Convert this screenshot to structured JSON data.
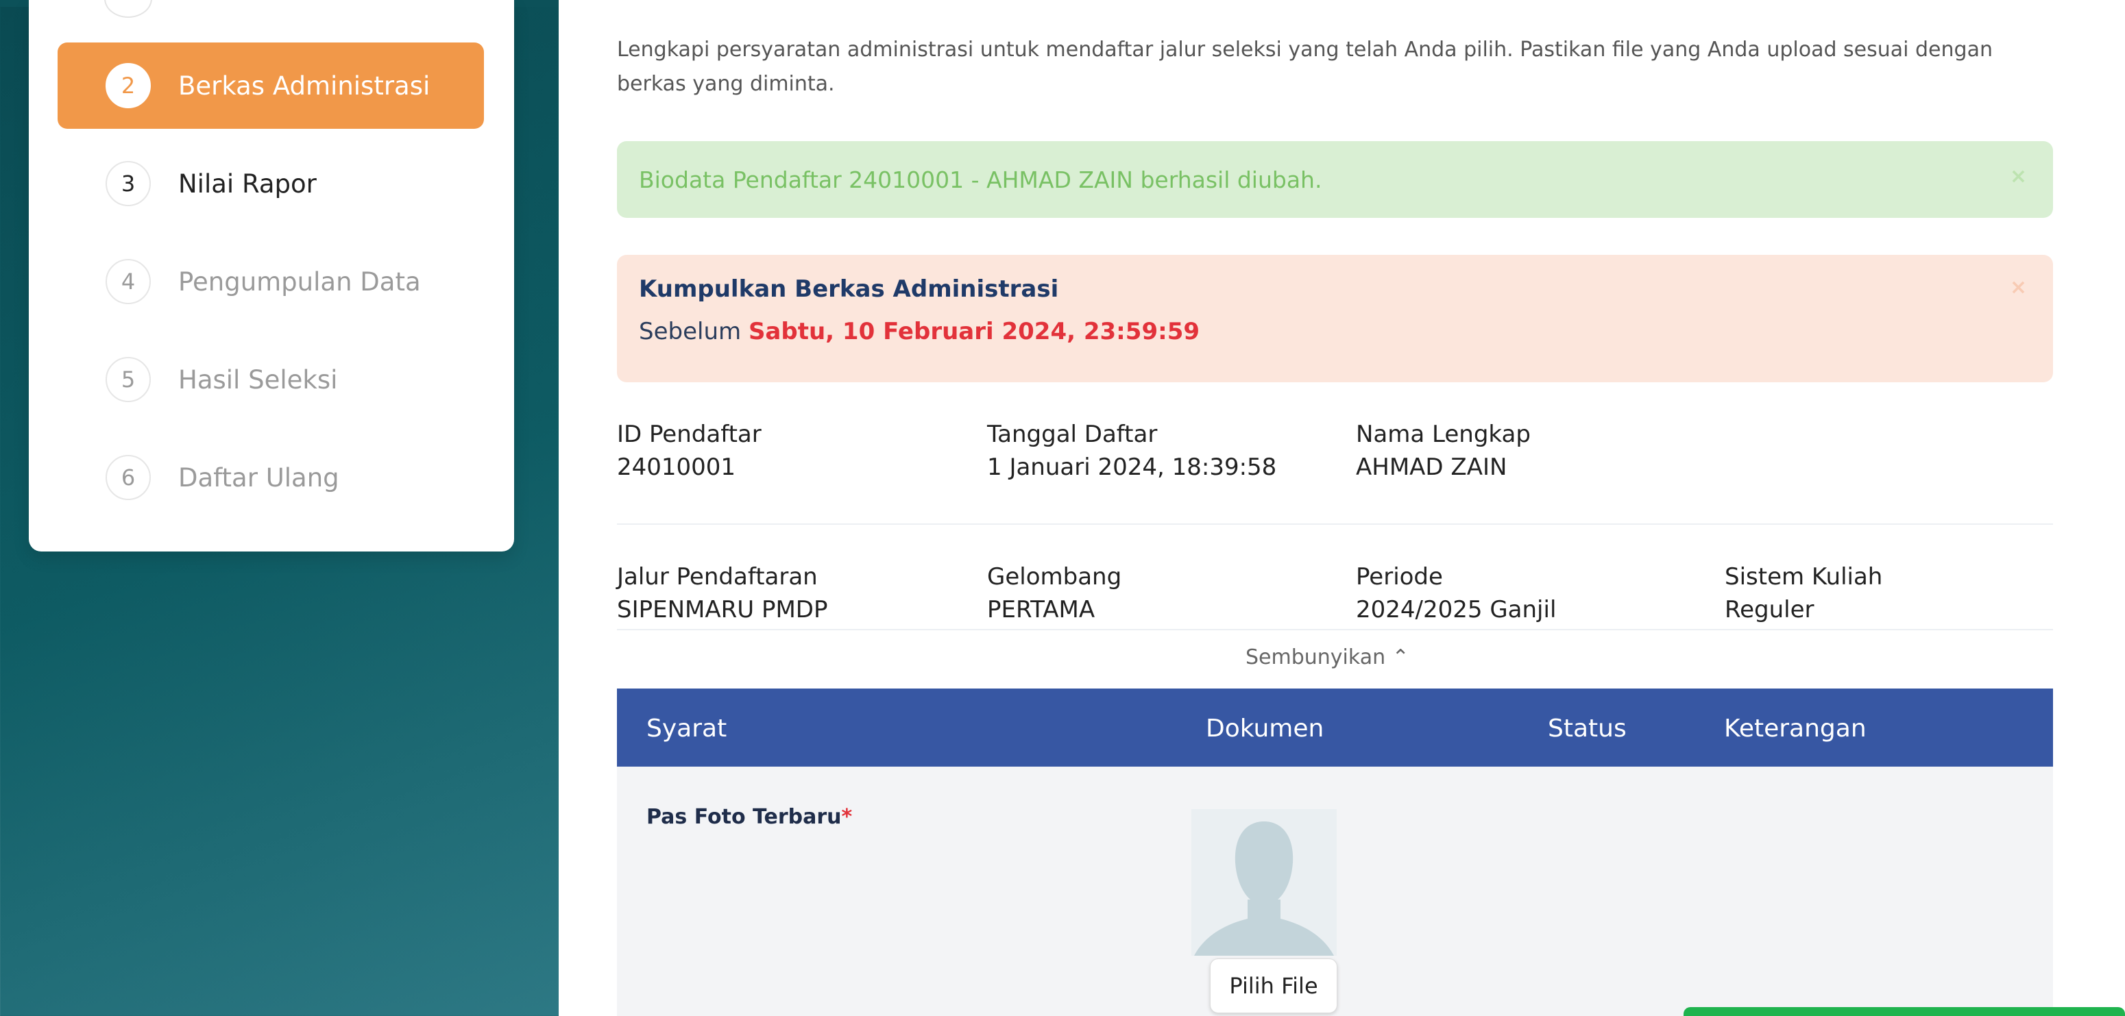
{
  "sidebar": {
    "steps": [
      {
        "num": "2",
        "label": "Berkas Administrasi"
      },
      {
        "num": "3",
        "label": "Nilai Rapor"
      },
      {
        "num": "4",
        "label": "Pengumpulan Data"
      },
      {
        "num": "5",
        "label": "Hasil Seleksi"
      },
      {
        "num": "6",
        "label": "Daftar Ulang"
      }
    ]
  },
  "main": {
    "intro": "Lengkapi persyaratan administrasi untuk mendaftar jalur seleksi yang telah Anda pilih. Pastikan file yang Anda upload sesuai dengan berkas yang diminta.",
    "success_alert": "Biodata Pendaftar 24010001 - AHMAD ZAIN berhasil diubah.",
    "close_glyph": "×",
    "warning": {
      "title": "Kumpulkan Berkas Administrasi",
      "prefix": "Sebelum",
      "deadline": "Sabtu, 10 Februari 2024, 23:59:59"
    },
    "info1": {
      "id_label": "ID Pendaftar",
      "id_value": "24010001",
      "date_label": "Tanggal Daftar",
      "date_value": "1 Januari 2024, 18:39:58",
      "name_label": "Nama Lengkap",
      "name_value": "AHMAD ZAIN"
    },
    "info2": {
      "path_label": "Jalur Pendaftaran",
      "path_value": "SIPENMARU PMDP",
      "wave_label": "Gelombang",
      "wave_value": "PERTAMA",
      "period_label": "Periode",
      "period_value": "2024/2025 Ganjil",
      "system_label": "Sistem Kuliah",
      "system_value": "Reguler"
    },
    "toggle": "Sembunyikan ⌃",
    "table": {
      "headers": {
        "syarat": "Syarat",
        "dokumen": "Dokumen",
        "status": "Status",
        "keterangan": "Keterangan"
      },
      "rows": [
        {
          "syarat": "Pas Foto Terbaru",
          "required_mark": "*",
          "button": "Pilih File"
        }
      ]
    }
  },
  "colors": {
    "accent_orange": "#f19849",
    "table_header": "#3757a3",
    "success_bg": "#d9efd3",
    "warning_bg": "#fce6dc",
    "deadline_red": "#e2323a"
  }
}
